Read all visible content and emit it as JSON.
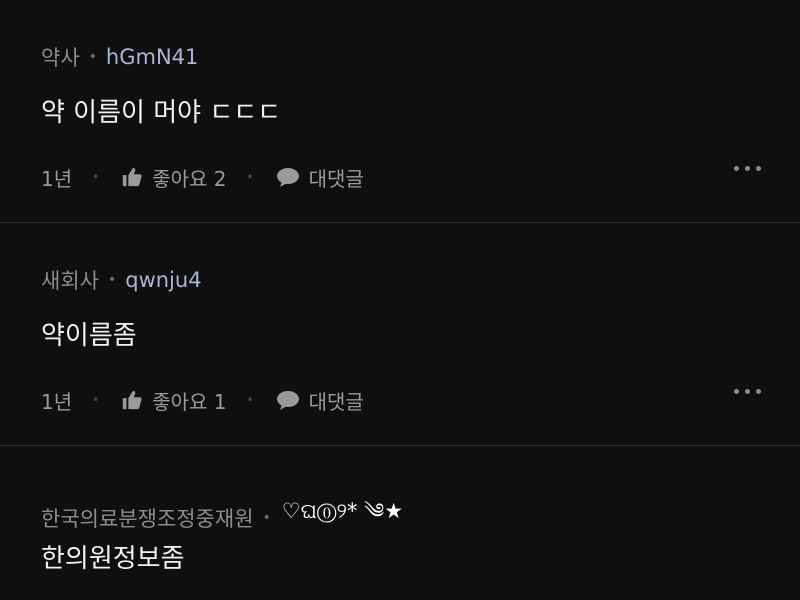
{
  "comments": [
    {
      "author": "약사",
      "nickname": "hGmN41",
      "decoration": "",
      "text": "약 이름이 머야 ㄷㄷㄷ",
      "time": "1년",
      "like_label": "좋아요 2",
      "reply_label": "대댓글"
    },
    {
      "author": "새회사",
      "nickname": "qwnju4",
      "decoration": "",
      "text": "약이름좀",
      "time": "1년",
      "like_label": "좋아요 1",
      "reply_label": "대댓글"
    },
    {
      "author": "한국의료분쟁조정중재원",
      "nickname": "",
      "decoration": "♡ଘ⓪୨* ༄★",
      "text": "한의원정보좀"
    }
  ],
  "colors": {
    "background": "#0f0f10",
    "text": "#f2f2f2",
    "meta": "#8c8c8f",
    "divider": "#2a2a2c"
  },
  "icons": [
    "thumbs-up-icon",
    "speech-bubble-icon",
    "more-dots-icon"
  ]
}
